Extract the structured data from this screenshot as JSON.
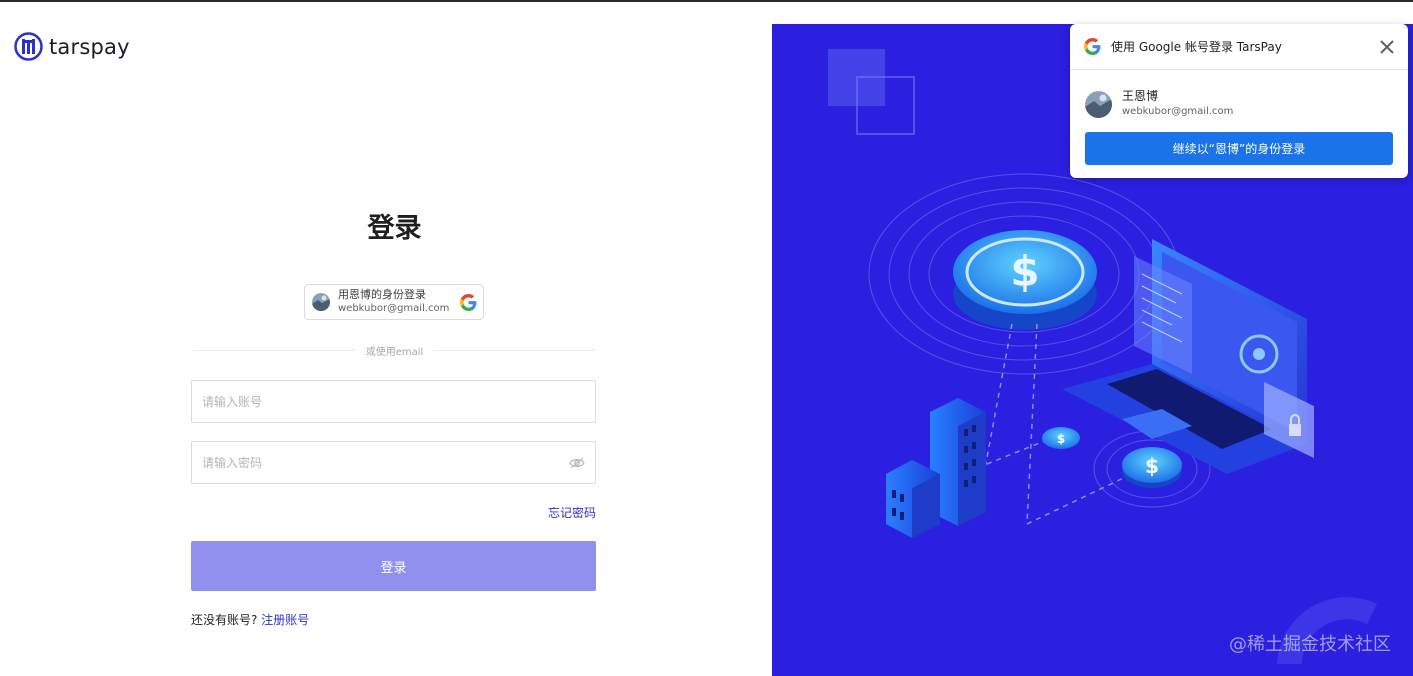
{
  "brand": {
    "name": "tarspay",
    "color": "#2c32c9"
  },
  "login": {
    "title": "登录",
    "google_button": {
      "line1": "用恩博的身份登录",
      "line2": "webkubor@gmail.com"
    },
    "divider_text": "或使用email",
    "account_placeholder": "请输入账号",
    "password_placeholder": "请输入密码",
    "forgot_password": "忘记密码",
    "submit_label": "登录",
    "no_account_text": "还没有账号?",
    "register_link": "注册账号",
    "submit_color": "#9190ee"
  },
  "illustration": {
    "background": "#2b1fe0",
    "watermark": "@稀土掘金技术社区"
  },
  "google_popup": {
    "header": "使用 Google 帐号登录 TarsPay",
    "account_name": "王恩博",
    "account_email": "webkubor@gmail.com",
    "continue_label": "继续以“恩博”的身份登录",
    "button_color": "#1a73e8"
  },
  "icons": [
    "tarspay-logo-icon",
    "google-g-icon",
    "avatar",
    "eye-icon",
    "close-icon"
  ]
}
